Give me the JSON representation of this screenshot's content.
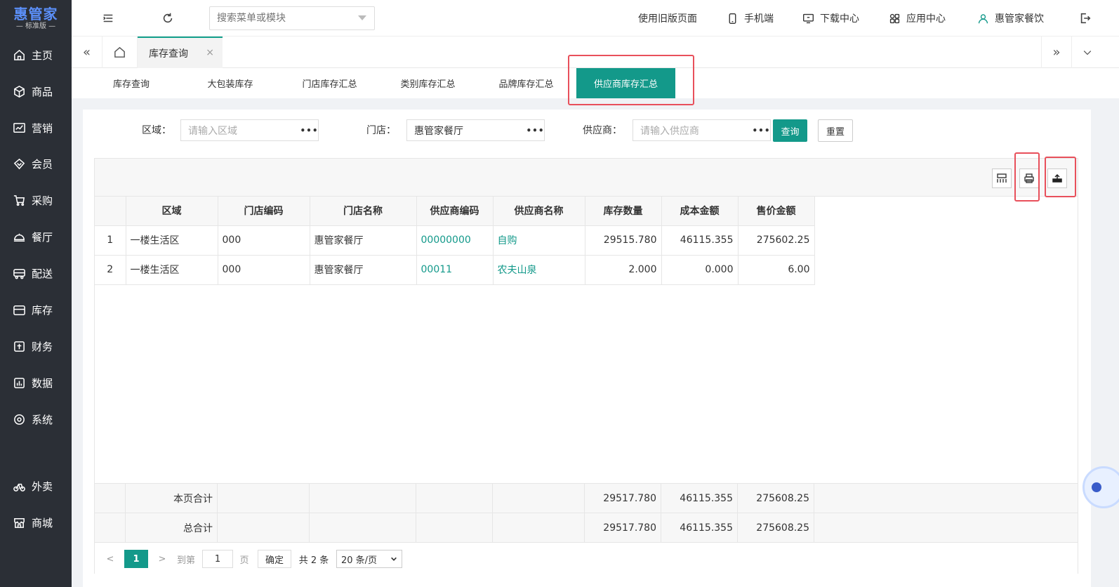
{
  "app": {
    "logo_title": "惠管家",
    "logo_sub": "— 标准版 —"
  },
  "sidebar": {
    "items": [
      {
        "label": "主页",
        "icon": "home-icon"
      },
      {
        "label": "商品",
        "icon": "box-icon"
      },
      {
        "label": "营销",
        "icon": "chart-icon"
      },
      {
        "label": "会员",
        "icon": "diamond-icon"
      },
      {
        "label": "采购",
        "icon": "cart-icon"
      },
      {
        "label": "餐厅",
        "icon": "cloche-icon"
      },
      {
        "label": "配送",
        "icon": "truck-icon"
      },
      {
        "label": "库存",
        "icon": "inventory-icon"
      },
      {
        "label": "财务",
        "icon": "finance-icon"
      },
      {
        "label": "数据",
        "icon": "data-icon"
      },
      {
        "label": "系统",
        "icon": "gear-icon"
      },
      {
        "label": "外卖",
        "icon": "bike-icon"
      },
      {
        "label": "商城",
        "icon": "store-icon"
      }
    ]
  },
  "header": {
    "search_placeholder": "搜索菜单或模块",
    "links": {
      "old_page": "使用旧版页面",
      "mobile": "手机端",
      "download": "下载中心",
      "apps": "应用中心",
      "user": "惠管家餐饮"
    }
  },
  "tabs": {
    "active": "库存查询",
    "close": "×"
  },
  "subtabs": [
    "库存查询",
    "大包装库存",
    "门店库存汇总",
    "类别库存汇总",
    "品牌库存汇总",
    "供应商库存汇总"
  ],
  "filters": {
    "region_label": "区域：",
    "region_placeholder": "请输入区域",
    "store_label": "门店：",
    "store_value": "惠管家餐厅",
    "supplier_label": "供应商：",
    "supplier_placeholder": "请输入供应商",
    "dots": "•••",
    "query_btn": "查询",
    "reset_btn": "重置"
  },
  "table": {
    "columns": [
      "",
      "区域",
      "门店编码",
      "门店名称",
      "供应商编码",
      "供应商名称",
      "库存数量",
      "成本金额",
      "售价金额"
    ],
    "rows": [
      [
        "1",
        "一楼生活区",
        "000",
        "惠管家餐厅",
        "00000000",
        "自购",
        "29515.780",
        "46115.355",
        "275602.25"
      ],
      [
        "2",
        "一楼生活区",
        "000",
        "惠管家餐厅",
        "00011",
        "农夫山泉",
        "2.000",
        "0.000",
        "6.00"
      ]
    ],
    "page_total": {
      "label": "本页合计",
      "qty": "29517.780",
      "cost": "46115.355",
      "price": "275608.25"
    },
    "grand_total": {
      "label": "总合计",
      "qty": "29517.780",
      "cost": "46115.355",
      "price": "275608.25"
    }
  },
  "pager": {
    "prev": "<",
    "current": "1",
    "next": ">",
    "goto_label": "到第",
    "goto_value": "1",
    "page_unit": "页",
    "confirm": "确定",
    "total": "共 2 条",
    "page_size": "20 条/页"
  },
  "colors": {
    "accent": "#13998a",
    "sidebar": "#2b2f36",
    "highlight": "#e8505b"
  }
}
